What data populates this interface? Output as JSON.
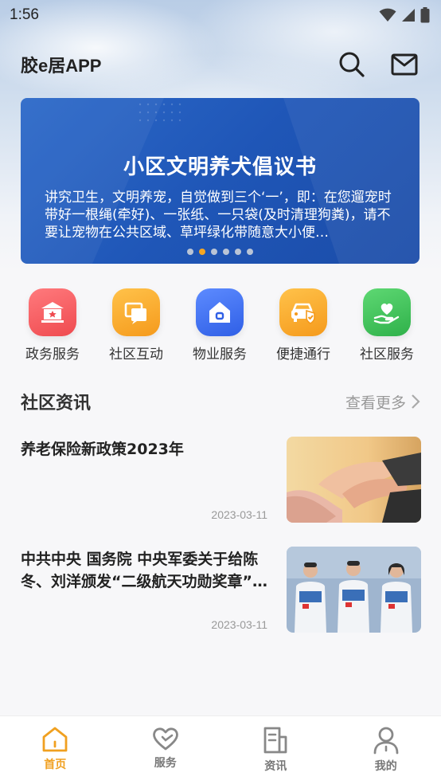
{
  "status_bar": {
    "time": "1:56"
  },
  "header": {
    "title": "胶e居APP",
    "search_icon": "search-icon",
    "mail_icon": "mail-icon"
  },
  "banner": {
    "title": "小区文明养犬倡议书",
    "body": "讲究卫生，文明养宠，自觉做到三个‘一’，即：在您遛宠时带好一根绳(牵好)、一张纸、一只袋(及时清理狗粪)，请不要让宠物在公共区域、草坪绿化带随意大小便…",
    "dots": [
      false,
      true,
      false,
      false,
      false,
      false
    ]
  },
  "quick_actions": [
    {
      "label": "政务服务",
      "icon": "government-icon",
      "color": "#f2565a"
    },
    {
      "label": "社区互动",
      "icon": "chat-icon",
      "color": "#f5a623"
    },
    {
      "label": "物业服务",
      "icon": "home-icon",
      "color": "#3d6ef0"
    },
    {
      "label": "便捷通行",
      "icon": "car-icon",
      "color": "#f5a623"
    },
    {
      "label": "社区服务",
      "icon": "heart-hand-icon",
      "color": "#3cc257"
    }
  ],
  "section": {
    "title": "社区资讯",
    "more": "查看更多"
  },
  "news": [
    {
      "title": "养老保险新政策2023年",
      "date": "2023-03-11"
    },
    {
      "title": "中共中央 国务院 中央军委关于给陈冬、刘洋颁发“二级航天功勋奖章”的决定",
      "date": "2023-03-11"
    }
  ],
  "tabs": [
    {
      "label": "首页",
      "icon": "home-tab-icon",
      "active": true
    },
    {
      "label": "服务",
      "icon": "service-heart-icon",
      "active": false
    },
    {
      "label": "资讯",
      "icon": "document-icon",
      "active": false
    },
    {
      "label": "我的",
      "icon": "user-icon",
      "active": false
    }
  ],
  "colors": {
    "accent": "#f0a020",
    "banner": "#1f56b7"
  }
}
